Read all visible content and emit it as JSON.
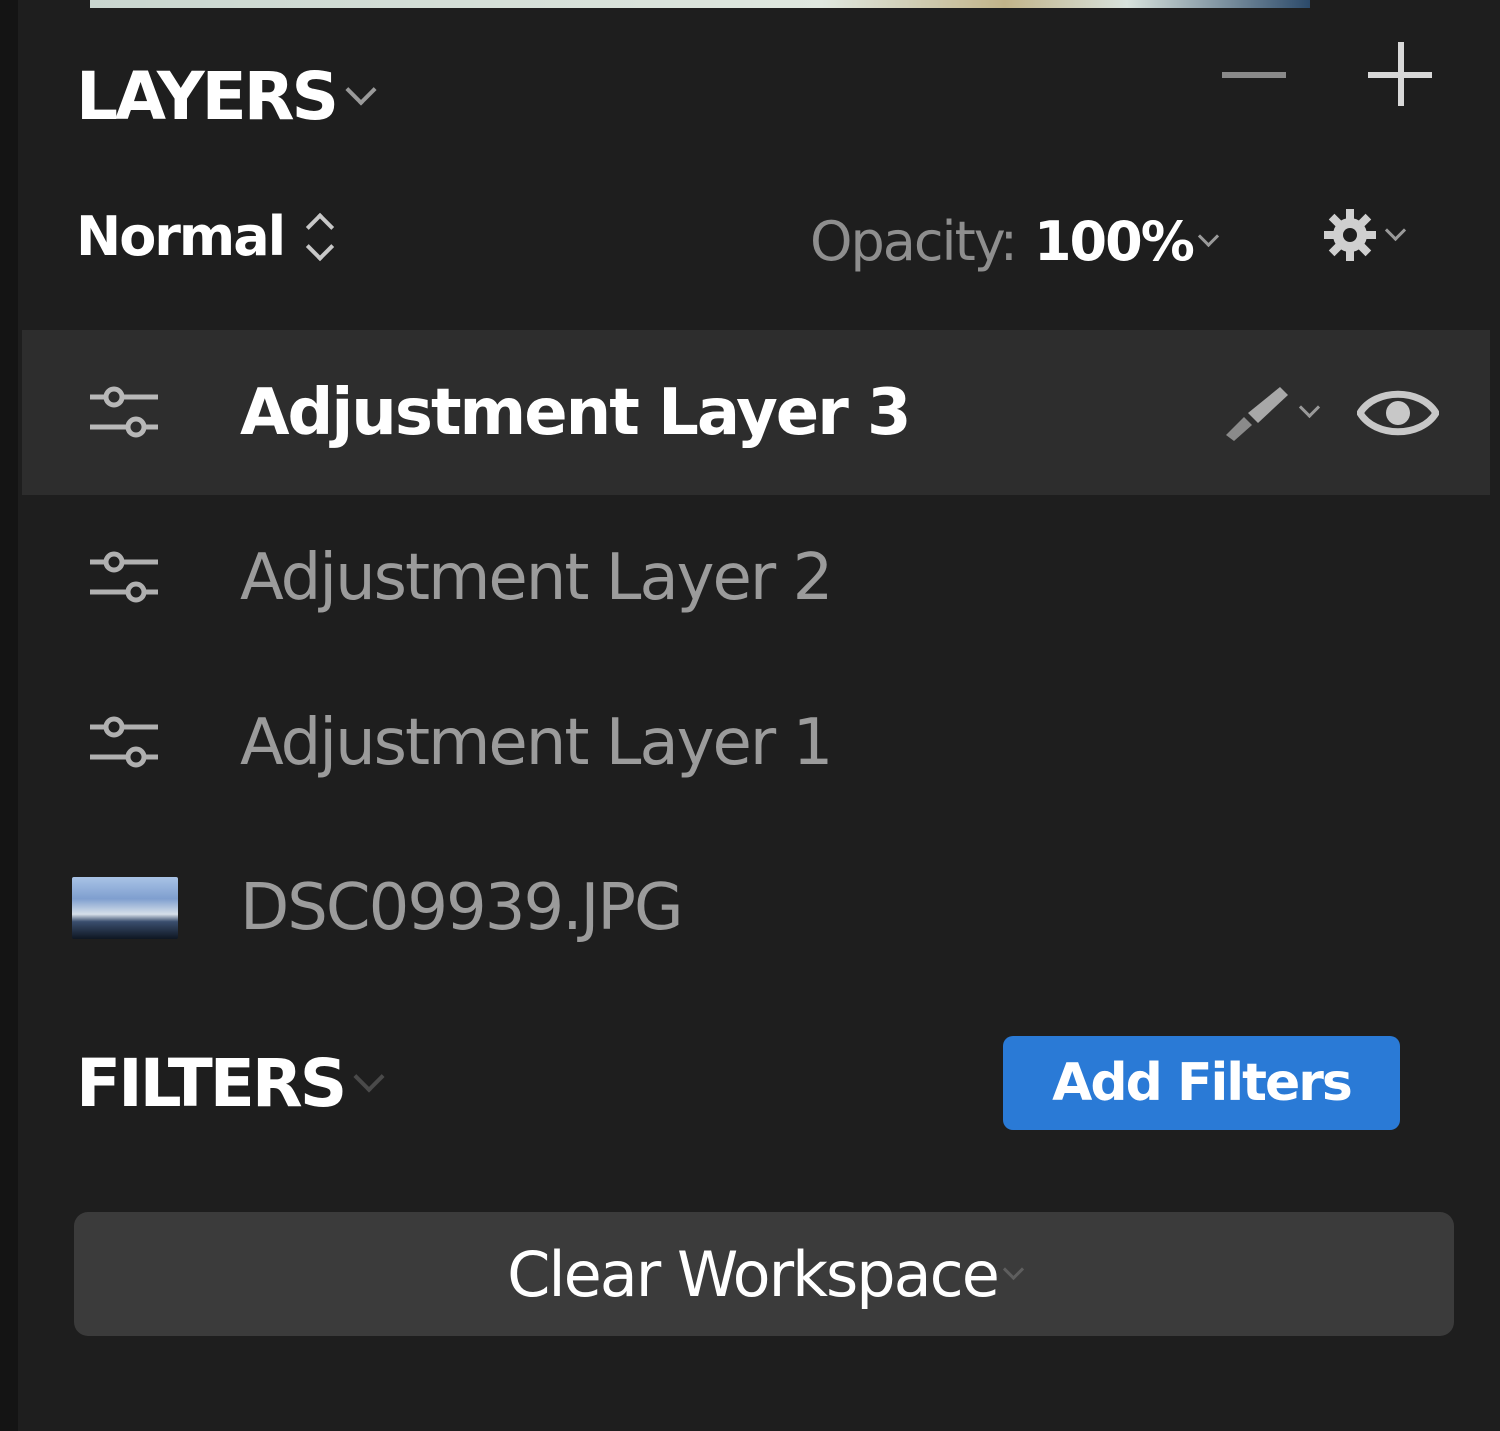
{
  "layers_panel": {
    "title": "LAYERS",
    "blend_mode": "Normal",
    "opacity_label": "Opacity:",
    "opacity_value": "100%",
    "items": [
      {
        "name": "Adjustment Layer 3",
        "type": "adjustment",
        "selected": true
      },
      {
        "name": "Adjustment Layer 2",
        "type": "adjustment",
        "selected": false
      },
      {
        "name": "Adjustment Layer 1",
        "type": "adjustment",
        "selected": false
      },
      {
        "name": "DSC09939.JPG",
        "type": "image",
        "selected": false
      }
    ]
  },
  "filters_panel": {
    "title": "FILTERS",
    "add_button_label": "Add Filters"
  },
  "clear_workspace_label": "Clear Workspace",
  "icons": {
    "header": [
      "chevron-down-icon",
      "minus-icon",
      "plus-icon"
    ],
    "blend": "updown-arrows-icon",
    "settings": "gear-icon",
    "adjustment_layer": "sliders-icon",
    "image_layer": "image-thumbnail",
    "mask": "brush-icon",
    "visibility": "eye-icon"
  },
  "colors": {
    "background": "#1e1e1e",
    "selected_row": "#2d2d2d",
    "accent_button": "#2a7ad6",
    "secondary_button": "#3b3b3b"
  }
}
